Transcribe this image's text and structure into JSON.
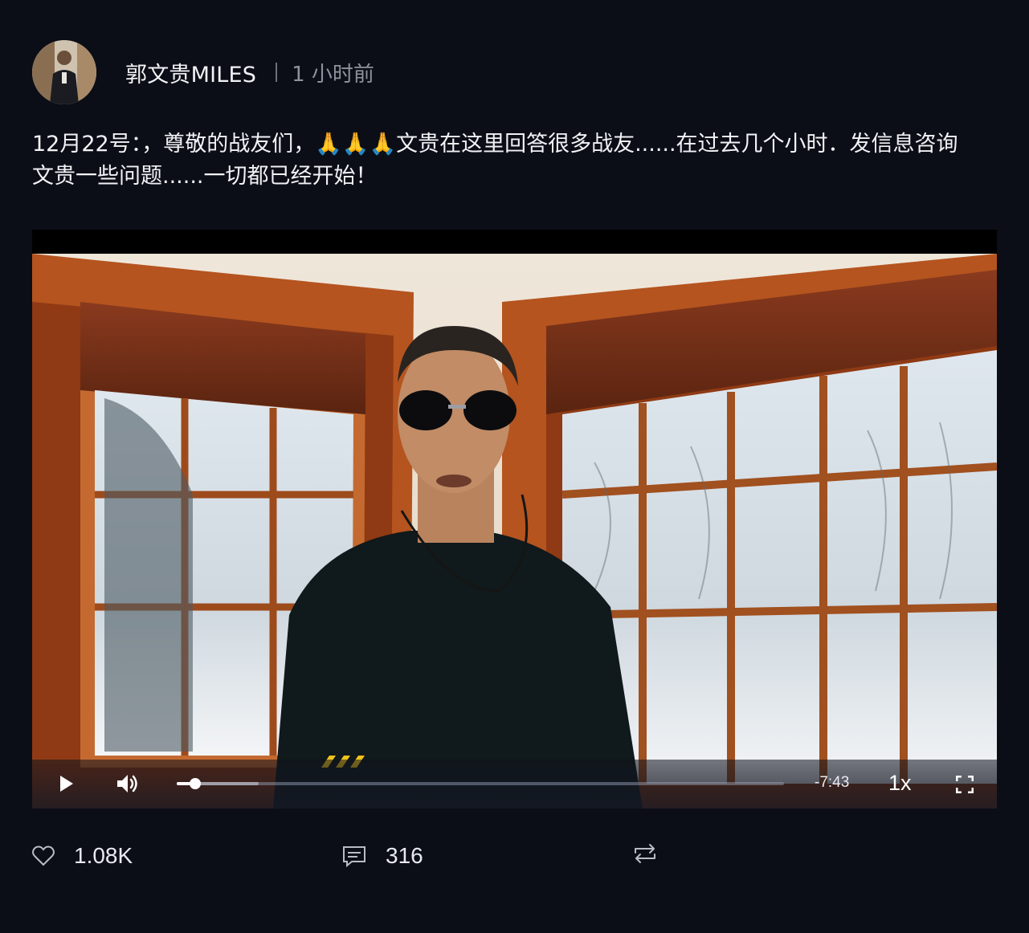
{
  "post": {
    "author": "郭文贵MILES",
    "time": "1 小时前",
    "text_line1": "12月22号：，尊敬的战友们，🙏🙏🙏文贵在这里回答很多战友......在过去几个小时．发信息咨询",
    "text_line2": "文贵一些问题......一切都已经开始！"
  },
  "video": {
    "remaining_time": "-7:43",
    "speed": "1x",
    "progress_played": 0.03,
    "progress_buffered": 0.135
  },
  "actions": {
    "likes": "1.08K",
    "comments": "316"
  },
  "icons": {
    "like": "heart-icon",
    "comment": "comment-icon",
    "repost": "repost-icon",
    "play": "play-icon",
    "volume": "volume-icon",
    "fullscreen": "fullscreen-icon"
  },
  "colors": {
    "background": "#0b0e16",
    "text": "#f1f2f6",
    "muted": "#8d929e"
  }
}
